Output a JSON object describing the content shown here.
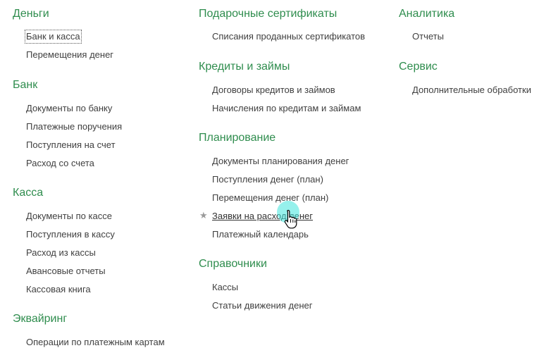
{
  "columns": [
    {
      "sections": [
        {
          "title": "Деньги",
          "items": [
            "Банк и касса",
            "Перемещения денег"
          ]
        },
        {
          "title": "Банк",
          "items": [
            "Документы по банку",
            "Платежные поручения",
            "Поступления на счет",
            "Расход со счета"
          ]
        },
        {
          "title": "Касса",
          "items": [
            "Документы по кассе",
            "Поступления в кассу",
            "Расход из кассы",
            "Авансовые отчеты",
            "Кассовая книга"
          ]
        },
        {
          "title": "Эквайринг",
          "items": [
            "Операции по платежным картам"
          ]
        }
      ]
    },
    {
      "sections": [
        {
          "title": "Подарочные сертификаты",
          "items": [
            "Списания проданных сертификатов"
          ]
        },
        {
          "title": "Кредиты и займы",
          "items": [
            "Договоры кредитов и займов",
            "Начисления по кредитам и займам"
          ]
        },
        {
          "title": "Планирование",
          "items": [
            "Документы планирования денег",
            "Поступления денег (план)",
            "Перемещения денег (план)",
            "Заявки на расход денег",
            "Платежный календарь"
          ]
        },
        {
          "title": "Справочники",
          "items": [
            "Кассы",
            "Статьи движения денег"
          ]
        }
      ]
    },
    {
      "sections": [
        {
          "title": "Аналитика",
          "items": [
            "Отчеты"
          ]
        },
        {
          "title": "Сервис",
          "items": [
            "Дополнительные обработки"
          ]
        }
      ]
    }
  ],
  "icons": {
    "favorite": "star-icon",
    "pointer": "hand-pointer-icon"
  },
  "colors": {
    "section_title": "#2f8d4e",
    "item_text": "#404040",
    "favorite_star": "#9a9a9a",
    "cursor_halo": "#40e6dc"
  }
}
